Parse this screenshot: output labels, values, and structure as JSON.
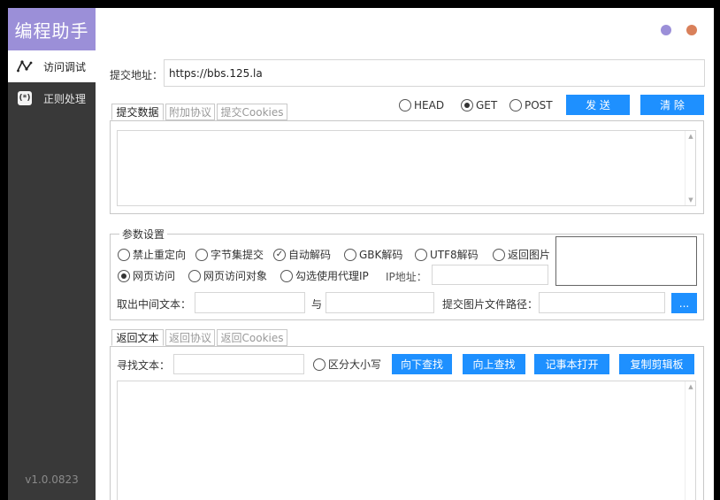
{
  "app": {
    "title": "编程助手",
    "version": "v1.0.0823"
  },
  "nav": [
    {
      "label": "访问调试",
      "icon": "pulse-icon"
    },
    {
      "label": "正则处理",
      "icon": "regex-icon"
    }
  ],
  "window_controls": {
    "minimize_color": "#9b8fd8",
    "close_color": "#d9805a"
  },
  "request": {
    "url_label": "提交地址：",
    "url_value": "https://bbs.125.la",
    "tabs": [
      "提交数据",
      "附加协议",
      "提交Cookies"
    ],
    "methods": [
      "HEAD",
      "GET",
      "POST"
    ],
    "selected_method": "GET",
    "send_label": "发 送",
    "clear_label": "清 除"
  },
  "params": {
    "title": "参数设置",
    "options_row1": [
      {
        "label": "禁止重定向",
        "checked": false
      },
      {
        "label": "字节集提交",
        "checked": false
      },
      {
        "label": "自动解码",
        "checked": true
      },
      {
        "label": "GBK解码",
        "checked": false
      },
      {
        "label": "UTF8解码",
        "checked": false
      },
      {
        "label": "返回图片",
        "checked": false
      }
    ],
    "options_row2": [
      {
        "label": "网页访问",
        "checked": true
      },
      {
        "label": "网页访问对象",
        "checked": false
      },
      {
        "label": "勾选使用代理IP",
        "checked": false
      }
    ],
    "ip_label": "IP地址：",
    "extract_label": "取出中间文本：",
    "and_label": "与",
    "image_path_label": "提交图片文件路径：",
    "browse_label": "..."
  },
  "response": {
    "tabs": [
      "返回文本",
      "返回协议",
      "返回Cookies"
    ],
    "find_label": "寻找文本：",
    "case_label": "区分大小写",
    "find_down": "向下查找",
    "find_up": "向上查找",
    "notepad": "记事本打开",
    "copy": "复制剪辑板"
  },
  "colors": {
    "accent": "#1e90ff",
    "sidebar": "#393939",
    "logo": "#9b8fd8"
  }
}
